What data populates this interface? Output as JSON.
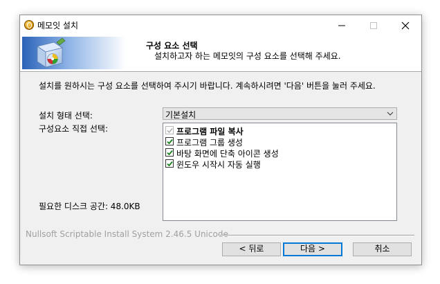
{
  "window": {
    "title": "메모잇 설치"
  },
  "header": {
    "title": "구성 요소 선택",
    "subtitle": "설치하고자 하는 메모잇의 구성 요소를 선택해 주세요."
  },
  "body": {
    "description": "설치를 원하시는 구성 요소를 선택하여 주시기 바랍니다. 계속하시려면 '다음' 버튼을 눌러 주세요.",
    "install_type_label": "설치 형태 선택:",
    "install_type_value": "기본설치",
    "components_label": "구성요소 직접 선택:",
    "space_label": "필요한 디스크 공간: 48.0KB",
    "components": [
      {
        "label": "프로그램 파일 복사",
        "checked": true,
        "disabled": true,
        "bold": true
      },
      {
        "label": "프로그램 그룹 생성",
        "checked": true,
        "disabled": false,
        "bold": false
      },
      {
        "label": "바탕 화면에 단축 아이콘 생성",
        "checked": true,
        "disabled": false,
        "bold": false
      },
      {
        "label": "윈도우 시작시 자동 실행",
        "checked": true,
        "disabled": false,
        "bold": false
      }
    ]
  },
  "footer": {
    "branding": "Nullsoft Scriptable Install System 2.46.5 Unicode",
    "back_label": "< 뒤로",
    "next_label": "다음 >",
    "cancel_label": "취소"
  },
  "colors": {
    "accent": "#0078d7",
    "check": "#1a7f1a",
    "check_disabled": "#b0b0b0"
  }
}
